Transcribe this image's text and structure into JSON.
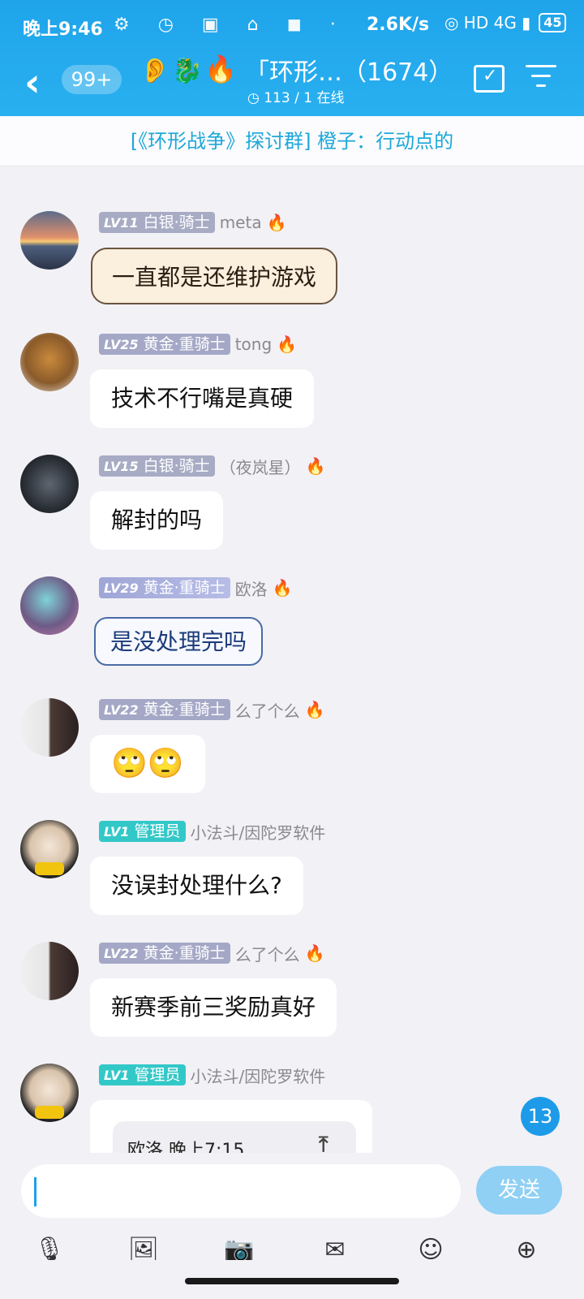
{
  "status_bar": {
    "time": "晚上9:46",
    "icons": "⚙ ◷ ▣ ⌂ ◼ ·",
    "net_speed": "2.6K/s",
    "right_icons": "◎ HD 4G ▮",
    "battery": "45"
  },
  "header": {
    "back_icon": "‹",
    "unread_count": "99+",
    "ear_icon": "👂",
    "dragon_icon": "🐉",
    "fire_icon": "🔥",
    "group_title": "「环形…（1674）",
    "online_status": "◷ 113 / 1 在线"
  },
  "notice": {
    "text": "[《环形战争》探讨群] 橙子：行动点的"
  },
  "messages": [
    {
      "level": "LV11",
      "rank": "白银·骑士",
      "nick": "meta",
      "fire": "🔥",
      "text": "一直都是还维护游戏"
    },
    {
      "level": "LV25",
      "rank": "黄金·重骑士",
      "nick": "tong",
      "fire": "🔥",
      "text": "技术不行嘴是真硬"
    },
    {
      "level": "LV15",
      "rank": "白银·骑士",
      "nick": "（夜岚星）",
      "fire": "🔥",
      "text": "解封的吗"
    },
    {
      "level": "LV29",
      "rank": "黄金·重骑士",
      "nick": "欧洛",
      "fire": "🔥",
      "text": "是没处理完吗"
    },
    {
      "level": "LV22",
      "rank": "黄金·重骑士",
      "nick": "么了个么",
      "fire": "🔥",
      "text": "🙄🙄"
    },
    {
      "level": "LV1",
      "rank": "管理员",
      "nick": "小法斗/因陀罗软件",
      "fire": "",
      "text": "没误封处理什么?"
    },
    {
      "level": "LV22",
      "rank": "黄金·重骑士",
      "nick": "么了个么",
      "fire": "🔥",
      "text": "新赛季前三奖励真好"
    },
    {
      "level": "LV1",
      "rank": "管理员",
      "nick": "小法斗/因陀罗软件",
      "fire": "",
      "quote": "欧洛 晚上7:15",
      "quote_icon": "⤒"
    }
  ],
  "unread_badge": "13",
  "input": {
    "send_label": "发送"
  },
  "toolbar_icons": [
    "mic-icon",
    "image-icon",
    "camera-icon",
    "red-packet-icon",
    "emoji-icon",
    "plus-icon"
  ],
  "toolbar_glyphs": [
    "🎙",
    "🖼",
    "📷",
    "✉",
    "☺",
    "⊕"
  ],
  "colors": {
    "header": "#1fa4ea",
    "accent": "#1d9be8",
    "admin_badge": "#33c8c8"
  }
}
